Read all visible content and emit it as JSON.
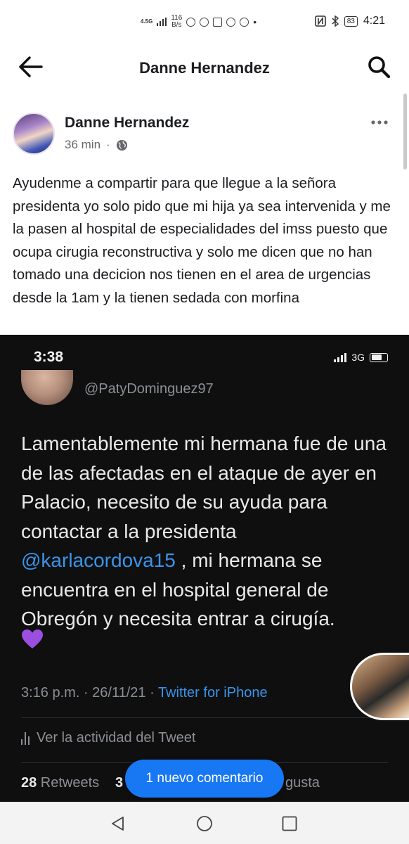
{
  "status_bar": {
    "network": "4.5G",
    "speed_value": "116",
    "speed_unit": "B/s",
    "battery": "83",
    "time": "4:21"
  },
  "header": {
    "title": "Danne Hernandez",
    "back_icon": "arrow-left-icon",
    "search_icon": "search-icon"
  },
  "post": {
    "author": "Danne Hernandez",
    "time": "36 min",
    "privacy_icon": "globe-icon",
    "text": "Ayudenme a compartir para que llegue a la señora presidenta  yo solo pido que mi hija ya sea intervenida y me la pasen al hospital de especialidades del imss puesto que ocupa cirugia reconstructiva y solo me dicen que no han tomado una decicion nos tienen en el area de urgencias desde la 1am y la tienen sedada  con morfina"
  },
  "embedded_tweet": {
    "phone_time": "3:38",
    "network": "3G",
    "handle": "@PatyDominguez97",
    "text_before": "Lamentablemente mi hermana fue de una de las afectadas en el ataque de ayer en Palacio, necesito de su ayuda para contactar a la presidenta ",
    "mention": "@karlacordova15",
    "text_after": " , mi hermana se encuentra en el hospital general de Obregón y necesita entrar a cirugía.",
    "heart_emoji": "purple-heart-icon",
    "timestamp": "3:16 p.m. · 26/11/21 · ",
    "source": "Twitter for iPhone",
    "activity_label": "Ver la actividad del Tweet",
    "retweets_count": "28",
    "retweets_label": " Retweets",
    "likes_count_partial": "3",
    "likes_label_partial": "gusta"
  },
  "new_comment_label": "1 nuevo comentario",
  "nav": {
    "back": "nav-back-icon",
    "home": "nav-home-icon",
    "recents": "nav-recents-icon"
  },
  "colors": {
    "accent": "#1877f2",
    "twitter_link": "#3a94e8",
    "tweet_bg": "#0f0f10"
  }
}
